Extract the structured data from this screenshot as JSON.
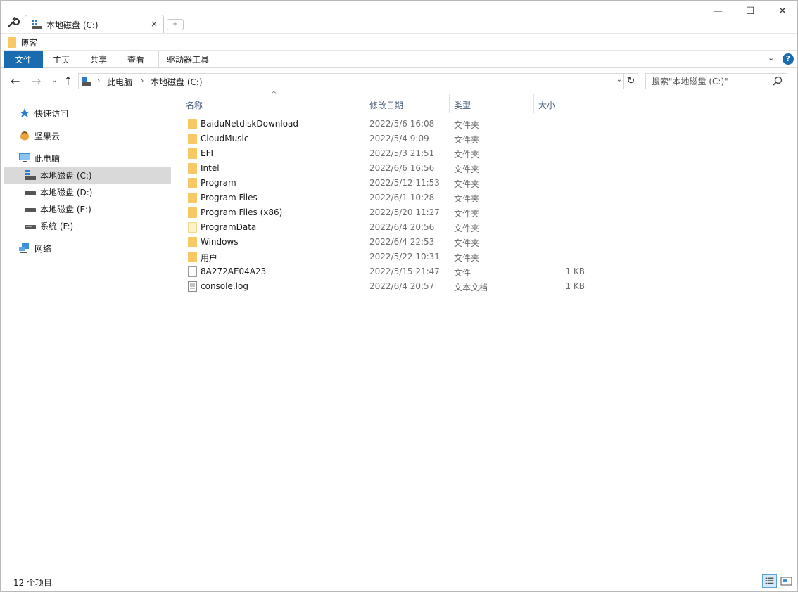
{
  "tab": {
    "title": "本地磁盘 (C:)",
    "close": "×",
    "new": "+"
  },
  "window_controls": {
    "minimize": "—",
    "maximize": "☐",
    "close": "✕"
  },
  "favorites": [
    {
      "label": "博客"
    }
  ],
  "ribbon": {
    "tabs": [
      "文件",
      "主页",
      "共享",
      "查看",
      "驱动器工具"
    ],
    "help": "?"
  },
  "address": {
    "crumbs": [
      "此电脑",
      "本地磁盘 (C:)"
    ],
    "separator": "›"
  },
  "search": {
    "placeholder": "搜索\"本地磁盘 (C:)\""
  },
  "sidebar": {
    "items": [
      {
        "label": "快速访问",
        "icon": "star-icon"
      },
      {
        "label": "坚果云",
        "icon": "nutstore-icon"
      },
      {
        "label": "此电脑",
        "icon": "computer-icon"
      },
      {
        "label": "本地磁盘 (C:)",
        "icon": "windows-drive-icon",
        "selected": true
      },
      {
        "label": "本地磁盘 (D:)",
        "icon": "drive-icon"
      },
      {
        "label": "本地磁盘 (E:)",
        "icon": "drive-icon"
      },
      {
        "label": "系统 (F:)",
        "icon": "drive-icon"
      },
      {
        "label": "网络",
        "icon": "network-icon"
      }
    ]
  },
  "columns": {
    "name": "名称",
    "date": "修改日期",
    "type": "类型",
    "size": "大小"
  },
  "files": [
    {
      "name": "BaiduNetdiskDownload",
      "date": "2022/5/6 16:08",
      "type": "文件夹",
      "size": "",
      "icon": "folder-icon"
    },
    {
      "name": "CloudMusic",
      "date": "2022/5/4 9:09",
      "type": "文件夹",
      "size": "",
      "icon": "folder-icon"
    },
    {
      "name": "EFI",
      "date": "2022/5/3 21:51",
      "type": "文件夹",
      "size": "",
      "icon": "folder-icon"
    },
    {
      "name": "Intel",
      "date": "2022/6/6 16:56",
      "type": "文件夹",
      "size": "",
      "icon": "folder-icon"
    },
    {
      "name": "Program",
      "date": "2022/5/12 11:53",
      "type": "文件夹",
      "size": "",
      "icon": "folder-icon"
    },
    {
      "name": "Program Files",
      "date": "2022/6/1 10:28",
      "type": "文件夹",
      "size": "",
      "icon": "folder-icon"
    },
    {
      "name": "Program Files (x86)",
      "date": "2022/5/20 11:27",
      "type": "文件夹",
      "size": "",
      "icon": "folder-icon"
    },
    {
      "name": "ProgramData",
      "date": "2022/6/4 20:56",
      "type": "文件夹",
      "size": "",
      "icon": "hidden-folder-icon"
    },
    {
      "name": "Windows",
      "date": "2022/6/4 22:53",
      "type": "文件夹",
      "size": "",
      "icon": "folder-icon"
    },
    {
      "name": "用户",
      "date": "2022/5/22 10:31",
      "type": "文件夹",
      "size": "",
      "icon": "folder-icon"
    },
    {
      "name": "8A272AE04A23",
      "date": "2022/5/15 21:47",
      "type": "文件",
      "size": "1 KB",
      "icon": "file-icon"
    },
    {
      "name": "console.log",
      "date": "2022/6/4 20:57",
      "type": "文本文档",
      "size": "1 KB",
      "icon": "text-document-icon"
    }
  ],
  "status": {
    "count": "12 个项目"
  },
  "colors": {
    "accent": "#1a6cb0",
    "selected": "#d9d9d9",
    "folder": "#f7c864"
  }
}
